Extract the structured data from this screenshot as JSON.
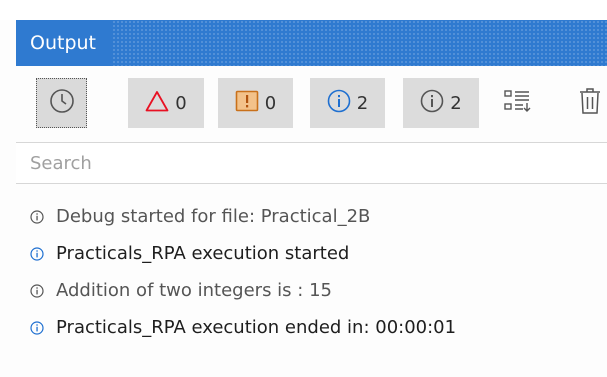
{
  "panel": {
    "title": "Output"
  },
  "toolbar": {
    "timestamps_icon": "clock-icon",
    "errors": {
      "icon": "error-triangle-icon",
      "count": "0",
      "color": "#e81123"
    },
    "warnings": {
      "icon": "warning-box-icon",
      "count": "0",
      "color": "#c9711b"
    },
    "info": {
      "icon": "info-circle-icon",
      "count": "2",
      "color": "#1e6fd0"
    },
    "trace": {
      "icon": "trace-circle-icon",
      "count": "2",
      "color": "#555555"
    },
    "filter_icon": "filter-list-icon",
    "clear_icon": "trash-icon"
  },
  "search": {
    "placeholder": "Search",
    "value": ""
  },
  "log": [
    {
      "level": "trace",
      "icon": "trace-circle-icon",
      "message": "Debug started for file: Practical_2B"
    },
    {
      "level": "info",
      "icon": "info-circle-icon",
      "message": "Practicals_RPA execution started"
    },
    {
      "level": "trace",
      "icon": "trace-circle-icon",
      "message": "Addition of two integers is : 15"
    },
    {
      "level": "info",
      "icon": "info-circle-icon",
      "message": "Practicals_RPA execution ended in: 00:00:01"
    }
  ]
}
